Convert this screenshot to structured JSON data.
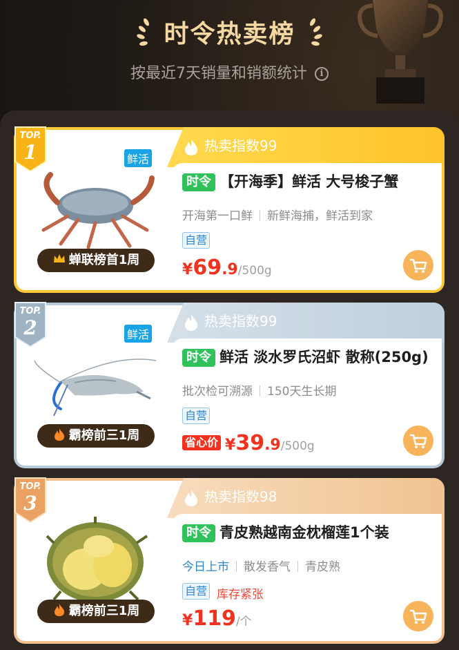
{
  "header": {
    "title": "时令热卖榜",
    "subtitle": "按最近7天销量和销额统计",
    "info_icon": "i"
  },
  "colors": {
    "accent_gold": "#ffc935",
    "accent_silver": "#b7c8d6",
    "accent_bronze": "#f1c28f",
    "price_red": "#f2321e",
    "season_green": "#2fc25b"
  },
  "items": [
    {
      "rank_label": "TOP.",
      "rank": "1",
      "heat": "热卖指数99",
      "fresh_tag": "鲜活",
      "image": "crab",
      "rank_pill": "蝉联榜首1周",
      "rank_pill_icon": "crown-icon",
      "season_tag": "时令",
      "name": "【开海季】鲜活 大号梭子蟹",
      "features": [
        "开海第一口鲜",
        "新鲜海捕，鲜活到家"
      ],
      "self_tag": "自营",
      "price_yen": "¥",
      "price_int": "69",
      "price_dec": ".9",
      "price_unit": "/500g"
    },
    {
      "rank_label": "TOP.",
      "rank": "2",
      "heat": "热卖指数99",
      "fresh_tag": "鲜活",
      "image": "shrimp",
      "rank_pill": "霸榜前三1周",
      "rank_pill_icon": "fire-icon",
      "season_tag": "时令",
      "name": "鲜活 淡水罗氏沼虾 散称(250g)",
      "features": [
        "批次检可溯源",
        "150天生长期"
      ],
      "self_tag": "自营",
      "saver_tag": "省心价",
      "price_yen": "¥",
      "price_int": "39",
      "price_dec": ".9",
      "price_unit": "/500g"
    },
    {
      "rank_label": "TOP.",
      "rank": "3",
      "heat": "热卖指数98",
      "image": "durian",
      "rank_pill": "霸榜前三1周",
      "rank_pill_icon": "fire-icon",
      "season_tag": "时令",
      "name": "青皮熟越南金枕榴莲1个装",
      "features_blue": "今日上市",
      "features": [
        "散发香气",
        "青皮熟"
      ],
      "self_tag": "自营",
      "stock_tag": "库存紧张",
      "price_yen": "¥",
      "price_int": "119",
      "price_dec": "",
      "price_unit": "/个"
    }
  ]
}
